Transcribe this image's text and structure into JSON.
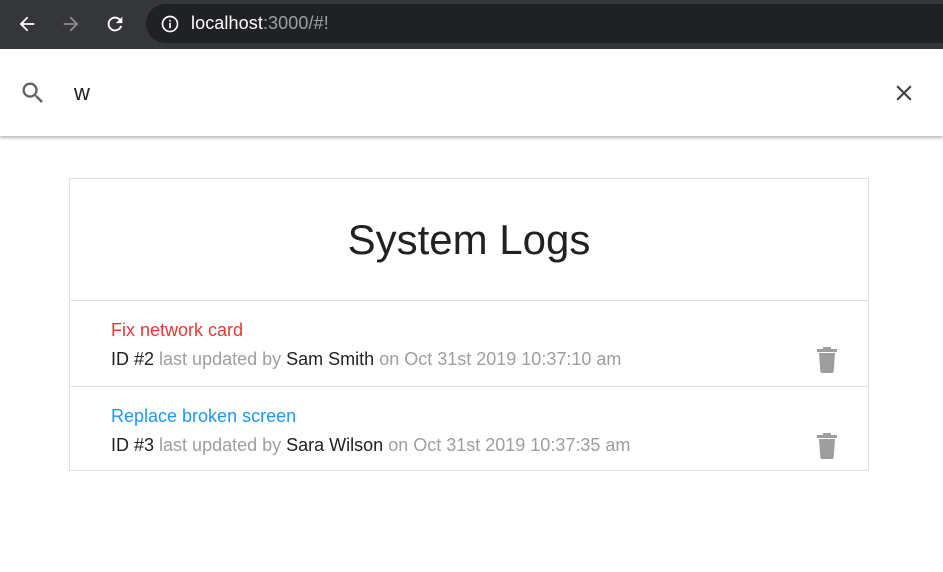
{
  "browser": {
    "url_host": "localhost",
    "url_rest": ":3000/#!"
  },
  "search": {
    "value": "w"
  },
  "card": {
    "title": "System Logs"
  },
  "logs": [
    {
      "message": "Fix network card",
      "message_color": "#e53935",
      "id_label": "ID #2",
      "updated_by_text": "last updated by",
      "tech": "Sam Smith",
      "date_text": "on Oct 31st 2019 10:37:10 am"
    },
    {
      "message": "Replace broken screen",
      "message_color": "#2196f3",
      "id_label": "ID #3",
      "updated_by_text": "last updated by",
      "tech": "Sara Wilson",
      "date_text": "on Oct 31st 2019 10:37:35 am"
    }
  ],
  "colors": {
    "toolbar": "#35363a",
    "omnibox": "#202124",
    "muted_text": "#9e9e9e",
    "trash_icon": "#9e9e9e"
  }
}
